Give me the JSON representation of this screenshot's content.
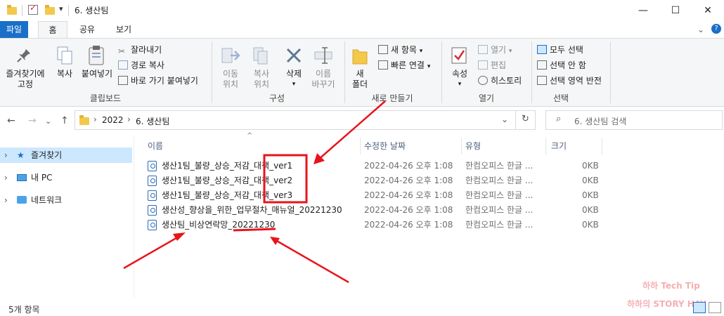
{
  "window": {
    "title": "6. 생산팀",
    "min_glyph": "—",
    "max_glyph": "☐",
    "close_glyph": "✕",
    "help_glyph": "?",
    "collapse_glyph": "⌄"
  },
  "tabs": [
    "파일",
    "홈",
    "공유",
    "보기"
  ],
  "ribbon": {
    "pin_line1": "즐겨찾기에",
    "pin_line2": "고정",
    "copy": "복사",
    "paste": "붙여넣기",
    "cut": "잘라내기",
    "copy_path": "경로 복사",
    "paste_shortcut": "바로 가기 붙여넣기",
    "clipboard": "클립보드",
    "move_line1": "이동",
    "move_line2": "위치",
    "copyto_line1": "복사",
    "copyto_line2": "위치",
    "delete": "삭제",
    "rename_line1": "이름",
    "rename_line2": "바꾸기",
    "organize": "구성",
    "newfolder_line1": "새",
    "newfolder_line2": "폴더",
    "new_item": "새 항목",
    "easy_access": "빠른 연결",
    "new": "새로 만들기",
    "properties": "속성",
    "open": "열기",
    "edit": "편집",
    "history": "히스토리",
    "open_group": "열기",
    "select_all": "모두 선택",
    "select_none": "선택 안 함",
    "invert": "선택 영역 반전",
    "select": "선택"
  },
  "address": {
    "crumb1": "2022",
    "crumb2": "6. 생산팀",
    "sep": "›",
    "search_placeholder": "6. 생산팀 검색",
    "refresh_glyph": "↻",
    "dropdown_glyph": "⌄"
  },
  "nav": {
    "back": "←",
    "forward": "→",
    "recent": "⌄",
    "up": "↑",
    "items": [
      "즐겨찾기",
      "내 PC",
      "네트워크"
    ]
  },
  "columns": {
    "name": "이름",
    "modified": "수정한 날짜",
    "type": "유형",
    "size": "크기"
  },
  "files": [
    {
      "name": "생산1팀_불량_상승_저감_대책_ver1",
      "modified": "2022-04-26 오후 1:08",
      "type": "한컴오피스 한글 ...",
      "size": "0KB"
    },
    {
      "name": "생산1팀_불량_상승_저감_대책_ver2",
      "modified": "2022-04-26 오후 1:08",
      "type": "한컴오피스 한글 ...",
      "size": "0KB"
    },
    {
      "name": "생산1팀_불량_상승_저감_대책_ver3",
      "modified": "2022-04-26 오후 1:08",
      "type": "한컴오피스 한글 ...",
      "size": "0KB"
    },
    {
      "name": "생산성_향상을_위한_업무절차_매뉴얼_20221230",
      "modified": "2022-04-26 오후 1:08",
      "type": "한컴오피스 한글 ...",
      "size": "0KB"
    },
    {
      "name": "생산팀_비상연락망_20221230",
      "modified": "2022-04-26 오후 1:08",
      "type": "한컴오피스 한글 ...",
      "size": "0KB"
    }
  ],
  "status": {
    "count": "5개 항목"
  },
  "watermark": {
    "line1": "하하 Tech Tip",
    "line2": "하하의 STORY HAY"
  },
  "colors": {
    "accent": "#1a6fc8",
    "selection": "#cce8ff",
    "annotation": "#e8141c"
  }
}
